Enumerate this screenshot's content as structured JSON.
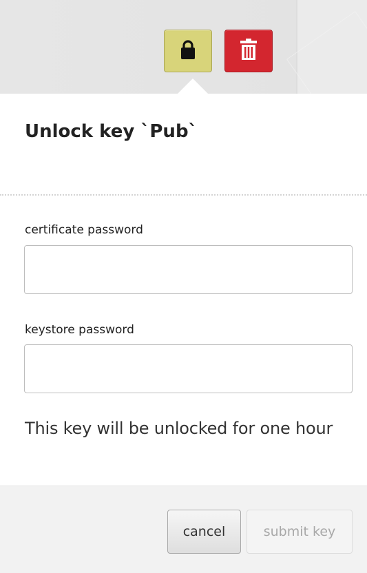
{
  "header": {
    "icons": {
      "lock": "lock-icon",
      "trash": "trash-icon"
    },
    "colors": {
      "lock_button": "#d8d47a",
      "delete_button": "#d3262f"
    }
  },
  "dialog": {
    "title": "Unlock key `Pub`",
    "certificate_password": {
      "label": "certificate password",
      "value": "",
      "placeholder": ""
    },
    "keystore_password": {
      "label": "keystore password",
      "value": "",
      "placeholder": ""
    },
    "info_text": "This key will be unlocked for one hour"
  },
  "footer": {
    "cancel_label": "cancel",
    "submit_label": "submit key"
  }
}
